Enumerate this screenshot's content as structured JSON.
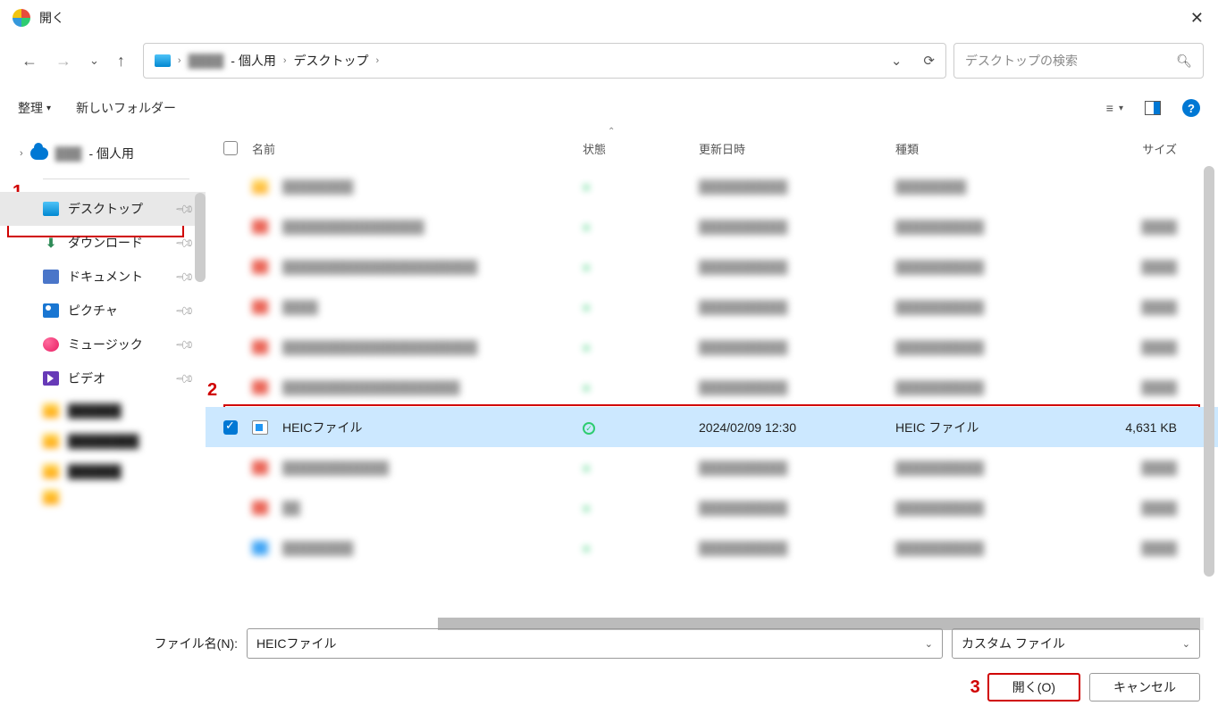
{
  "title": "開く",
  "breadcrumb": {
    "personal": "- 個人用",
    "desktop": "デスクトップ"
  },
  "search_placeholder": "デスクトップの検索",
  "toolbar": {
    "organize": "整理",
    "new_folder": "新しいフォルダー"
  },
  "sidebar": {
    "onedrive_suffix": "- 個人用",
    "items": [
      {
        "label": "デスクトップ"
      },
      {
        "label": "ダウンロード"
      },
      {
        "label": "ドキュメント"
      },
      {
        "label": "ピクチャ"
      },
      {
        "label": "ミュージック"
      },
      {
        "label": "ビデオ"
      }
    ]
  },
  "columns": {
    "name": "名前",
    "state": "状態",
    "date": "更新日時",
    "type": "種類",
    "size": "サイズ"
  },
  "selected_file": {
    "name": "HEICファイル",
    "date": "2024/02/09 12:30",
    "type": "HEIC ファイル",
    "size": "4,631 KB"
  },
  "footer": {
    "filename_label": "ファイル名(N):",
    "filename_value": "HEICファイル",
    "filetype": "カスタム ファイル",
    "open": "開く(O)",
    "cancel": "キャンセル"
  },
  "annotations": {
    "a1": "1",
    "a2": "2",
    "a3": "3"
  }
}
